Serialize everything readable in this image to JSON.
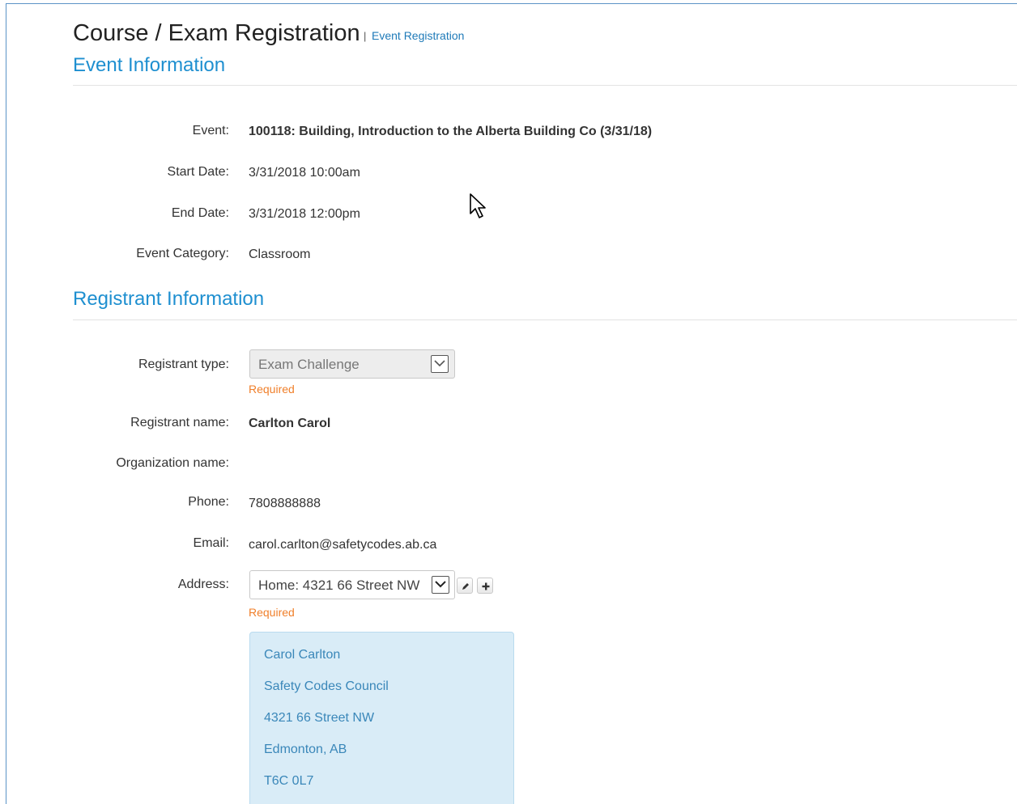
{
  "header": {
    "title": "Course / Exam Registration",
    "separator": "|",
    "breadcrumb": "Event Registration"
  },
  "event_info": {
    "heading": "Event Information",
    "fields": [
      {
        "label": "Event:",
        "value": "100118: Building, Introduction to the Alberta Building Co (3/31/18)"
      },
      {
        "label": "Start Date:",
        "value": "3/31/2018 10:00am"
      },
      {
        "label": "End Date:",
        "value": "3/31/2018 12:00pm"
      },
      {
        "label": "Event Category:",
        "value": "Classroom"
      }
    ]
  },
  "registrant_info": {
    "heading": "Registrant Information",
    "type_label": "Registrant type:",
    "type_value": "Exam Challenge",
    "type_required": "Required",
    "name_label": "Registrant name:",
    "name_value": "Carlton Carol",
    "org_label": "Organization name:",
    "org_value": "",
    "phone_label": "Phone:",
    "phone_value": "7808888888",
    "email_label": "Email:",
    "email_value": "carol.carlton@safetycodes.ab.ca",
    "address_label": "Address:",
    "address_value": "Home: 4321 66 Street NW",
    "address_required": "Required",
    "address_card": [
      "Carol Carlton",
      "Safety Codes Council",
      "4321 66 Street NW",
      "Edmonton, AB",
      "T6C 0L7"
    ]
  },
  "icons": {
    "edit": "pencil-icon",
    "add": "plus-icon",
    "dropdown": "chevron-down-icon"
  },
  "colors": {
    "section_heading": "#1e8fd0",
    "required": "#f07f2a",
    "address_card_bg": "#d9ecf7",
    "address_card_text": "#3a87b9"
  }
}
